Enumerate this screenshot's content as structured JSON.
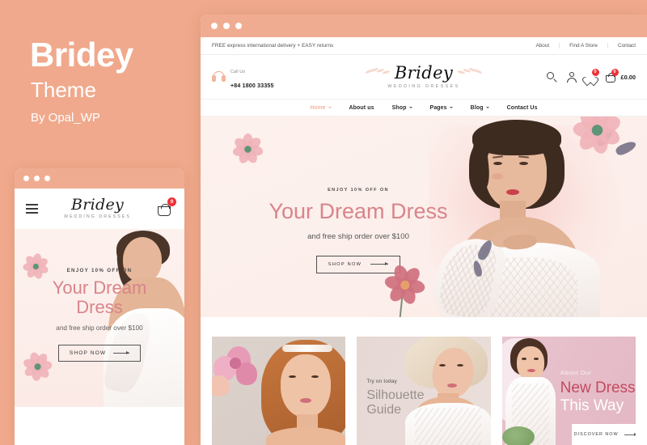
{
  "promo": {
    "title": "Bridey",
    "subtitle": "Theme",
    "author": "By Opal_WP"
  },
  "colors": {
    "background": "#F0A98C",
    "accent": "#EE9A7E",
    "heading_pink": "#D9848A",
    "badge_red": "#ED3237",
    "hero_bg": "#FDF1EE"
  },
  "browser": {
    "topbar": {
      "announcement": "FREE express international delivery + EASY returns",
      "links": [
        "About",
        "Find A Store",
        "Contact"
      ]
    },
    "header": {
      "call_label": "Call Us",
      "phone": "+84 1800 33355",
      "phone_icon": "headphone-icon",
      "logo": {
        "name": "Bridey",
        "tagline": "WEDDING DRESSES"
      },
      "icons": [
        {
          "name": "search-icon",
          "badge": null
        },
        {
          "name": "user-account-icon",
          "badge": null
        },
        {
          "name": "wishlist-heart-icon",
          "badge": "0"
        },
        {
          "name": "shopping-cart-icon",
          "badge": "0"
        }
      ],
      "cart_total": "£0.00"
    },
    "nav": [
      {
        "label": "Home",
        "has_dropdown": true,
        "active": true
      },
      {
        "label": "About us",
        "has_dropdown": false,
        "active": false
      },
      {
        "label": "Shop",
        "has_dropdown": true,
        "active": false
      },
      {
        "label": "Pages",
        "has_dropdown": true,
        "active": false
      },
      {
        "label": "Blog",
        "has_dropdown": true,
        "active": false
      },
      {
        "label": "Contact Us",
        "has_dropdown": false,
        "active": false
      }
    ],
    "hero": {
      "eyebrow": "ENJOY 10% OFF ON",
      "title": "Your Dream Dress",
      "description": "and free ship order over $100",
      "button": "SHOP NOW"
    },
    "cards": [
      {
        "eyebrow": "",
        "title": "",
        "title2": "",
        "button": ""
      },
      {
        "eyebrow": "Try on today",
        "title": "Silhouette",
        "title2": "Guide",
        "button": ""
      },
      {
        "eyebrow": "About Our",
        "title": "New Dress",
        "title2": "This Way",
        "button": "DISCOVER NOW"
      }
    ]
  },
  "mobile": {
    "menu_icon": "hamburger-menu-icon",
    "logo": {
      "name": "Bridey",
      "tagline": "WEDDING DRESSES"
    },
    "cart_icon": "shopping-cart-icon",
    "cart_badge": "0",
    "hero": {
      "eyebrow": "ENJOY 10% OFF ON",
      "title_line1": "Your Dream",
      "title_line2": "Dress",
      "description": "and free ship order over $100",
      "button": "SHOP NOW"
    }
  }
}
